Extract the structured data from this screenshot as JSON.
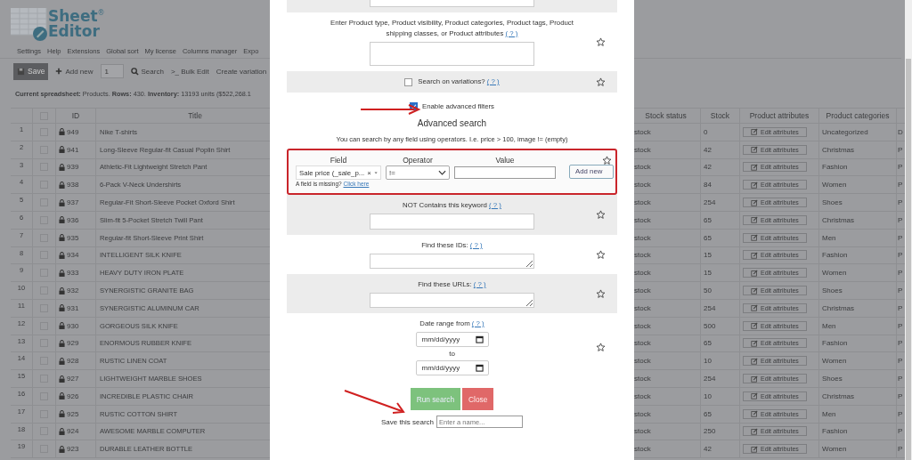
{
  "logo": {
    "words": [
      "Sheet",
      "Editor"
    ],
    "registered": "®"
  },
  "menu": [
    "Settings",
    "Help",
    "Extensions",
    "Global sort",
    "My license",
    "Columns manager",
    "Expo"
  ],
  "toolbar": [
    {
      "kind": "save",
      "label": "Save"
    },
    {
      "kind": "add",
      "label": "Add new"
    },
    {
      "kind": "number",
      "value": "1"
    },
    {
      "kind": "search",
      "label": "Search"
    },
    {
      "kind": "bulk",
      "prefix": ">_",
      "label": "Bulk Edit"
    },
    {
      "kind": "plain",
      "label": "Create variation"
    }
  ],
  "info": "**Current spreadsheet:** Products. **Rows:** 430. **Inventory:** 13193 units ($522,268.1",
  "table": {
    "select_all_checked": false,
    "columns": [
      "ID",
      "Title",
      "Stock status",
      "Stock",
      "Product attributes",
      "Product categories"
    ],
    "rows": [
      {
        "number": "1",
        "checked": false,
        "id": "949",
        "title": "Nike T-shirts",
        "stock_status": "stock",
        "stock": "0",
        "attributes": "Edit attributes",
        "category": "Uncategorized",
        "column_9": "D"
      },
      {
        "number": "2",
        "checked": false,
        "id": "941",
        "title": "Long-Sleeve Regular-fit Casual Poplin Shirt",
        "stock_status": "stock",
        "stock": "42",
        "attributes": "Edit attributes",
        "category": "Christmas",
        "column_9": "P"
      },
      {
        "number": "3",
        "checked": false,
        "id": "939",
        "title": "Athletic-Fit Lightweight Stretch Pant",
        "stock_status": "stock",
        "stock": "42",
        "attributes": "Edit attributes",
        "category": "Fashion",
        "column_9": "P"
      },
      {
        "number": "4",
        "checked": false,
        "id": "938",
        "title": "6-Pack V-Neck Undershirts",
        "stock_status": "stock",
        "stock": "84",
        "attributes": "Edit attributes",
        "category": "Women",
        "column_9": "P"
      },
      {
        "number": "5",
        "checked": false,
        "id": "937",
        "title": "Regular-Fit Short-Sleeve Pocket Oxford Shirt",
        "stock_status": "stock",
        "stock": "254",
        "attributes": "Edit attributes",
        "category": "Shoes",
        "column_9": "P"
      },
      {
        "number": "6",
        "checked": false,
        "id": "936",
        "title": "Slim-fit 5-Pocket Stretch Twill Pant",
        "stock_status": "stock",
        "stock": "65",
        "attributes": "Edit attributes",
        "category": "Christmas",
        "column_9": "P"
      },
      {
        "number": "7",
        "checked": false,
        "id": "935",
        "title": "Regular-fit Short-Sleeve Print Shirt",
        "stock_status": "stock",
        "stock": "65",
        "attributes": "Edit attributes",
        "category": "Men",
        "column_9": "P"
      },
      {
        "number": "8",
        "checked": false,
        "id": "934",
        "title": "INTELLIGENT SILK KNIFE",
        "stock_status": "stock",
        "stock": "15",
        "attributes": "Edit attributes",
        "category": "Fashion",
        "column_9": "P"
      },
      {
        "number": "9",
        "checked": false,
        "id": "933",
        "title": "HEAVY DUTY IRON PLATE",
        "stock_status": "stock",
        "stock": "15",
        "attributes": "Edit attributes",
        "category": "Women",
        "column_9": "P"
      },
      {
        "number": "10",
        "checked": false,
        "id": "932",
        "title": "SYNERGISTIC GRANITE BAG",
        "stock_status": "stock",
        "stock": "50",
        "attributes": "Edit attributes",
        "category": "Shoes",
        "column_9": "P"
      },
      {
        "number": "11",
        "checked": false,
        "id": "931",
        "title": "SYNERGISTIC ALUMINUM CAR",
        "stock_status": "stock",
        "stock": "254",
        "attributes": "Edit attributes",
        "category": "Christmas",
        "column_9": "P"
      },
      {
        "number": "12",
        "checked": false,
        "id": "930",
        "title": "GORGEOUS SILK KNIFE",
        "stock_status": "stock",
        "stock": "500",
        "attributes": "Edit attributes",
        "category": "Men",
        "column_9": "P"
      },
      {
        "number": "13",
        "checked": false,
        "id": "929",
        "title": "ENORMOUS RUBBER KNIFE",
        "stock_status": "stock",
        "stock": "65",
        "attributes": "Edit attributes",
        "category": "Fashion",
        "column_9": "P"
      },
      {
        "number": "14",
        "checked": false,
        "id": "928",
        "title": "RUSTIC LINEN COAT",
        "stock_status": "stock",
        "stock": "10",
        "attributes": "Edit attributes",
        "category": "Women",
        "column_9": "P"
      },
      {
        "number": "15",
        "checked": false,
        "id": "927",
        "title": "LIGHTWEIGHT MARBLE SHOES",
        "stock_status": "stock",
        "stock": "254",
        "attributes": "Edit attributes",
        "category": "Shoes",
        "column_9": "P"
      },
      {
        "number": "16",
        "checked": false,
        "id": "926",
        "title": "INCREDIBLE PLASTIC CHAIR",
        "stock_status": "stock",
        "stock": "10",
        "attributes": "Edit attributes",
        "category": "Christmas",
        "column_9": "P"
      },
      {
        "number": "17",
        "checked": false,
        "id": "925",
        "title": "RUSTIC COTTON SHIRT",
        "stock_status": "stock",
        "stock": "65",
        "attributes": "Edit attributes",
        "category": "Men",
        "column_9": "P"
      },
      {
        "number": "18",
        "checked": false,
        "id": "924",
        "title": "AWESOME MARBLE COMPUTER",
        "stock_status": "stock",
        "stock": "250",
        "attributes": "Edit attributes",
        "category": "Fashion",
        "column_9": "P"
      },
      {
        "number": "19",
        "checked": false,
        "id": "923",
        "title": "DURABLE LEATHER BOTTLE",
        "stock_status": "stock",
        "stock": "42",
        "attributes": "Edit attributes",
        "category": "Women",
        "column_9": "P"
      }
    ]
  },
  "modal": {
    "sections_top": [
      {
        "kind": "input",
        "shaded": true
      },
      {
        "kind": "input",
        "shaded": false,
        "label": "Enter Product type, Product visibility, Product categories, Product tags, Product shipping classes, or Product attributes",
        "help": "( ? )"
      },
      {
        "kind": "checkbox",
        "shaded": true,
        "label": "Search on variations?",
        "help": "( ? )",
        "checked": false
      }
    ],
    "enable_advanced": {
      "label": "Enable advanced filters",
      "checked": true
    },
    "advanced_title": "Advanced search",
    "advanced_hint": "You can search by any field using operators. I.e. price > 100, image != (empty)",
    "filter": {
      "field_label": "Field",
      "operator_label": "Operator",
      "value_label": "Value",
      "field": "Sale price (_sale_p...",
      "clear": "×",
      "operator": "!=",
      "add": "Add new",
      "missing": "A field is missing?",
      "missing_link": "Click here"
    },
    "sections_bottom": [
      {
        "kind": "input",
        "shaded": true,
        "label": "NOT Contains this keyword",
        "help": "( ? )"
      },
      {
        "kind": "textarea",
        "shaded": false,
        "label": "Find these IDs:",
        "help": "( ? )"
      },
      {
        "kind": "textarea",
        "shaded": true,
        "label": "Find these URLs:",
        "help": "( ? )"
      },
      {
        "kind": "date",
        "shaded": false,
        "label": "Date range from",
        "help": "( ? )",
        "from_placeholder": "mm/dd/yyyy",
        "to": "to",
        "to_placeholder": "mm/dd/yyyy"
      }
    ],
    "run": "Run search",
    "close": "Close",
    "save": {
      "label": "Save this search",
      "placeholder": "Enter a name..."
    }
  }
}
